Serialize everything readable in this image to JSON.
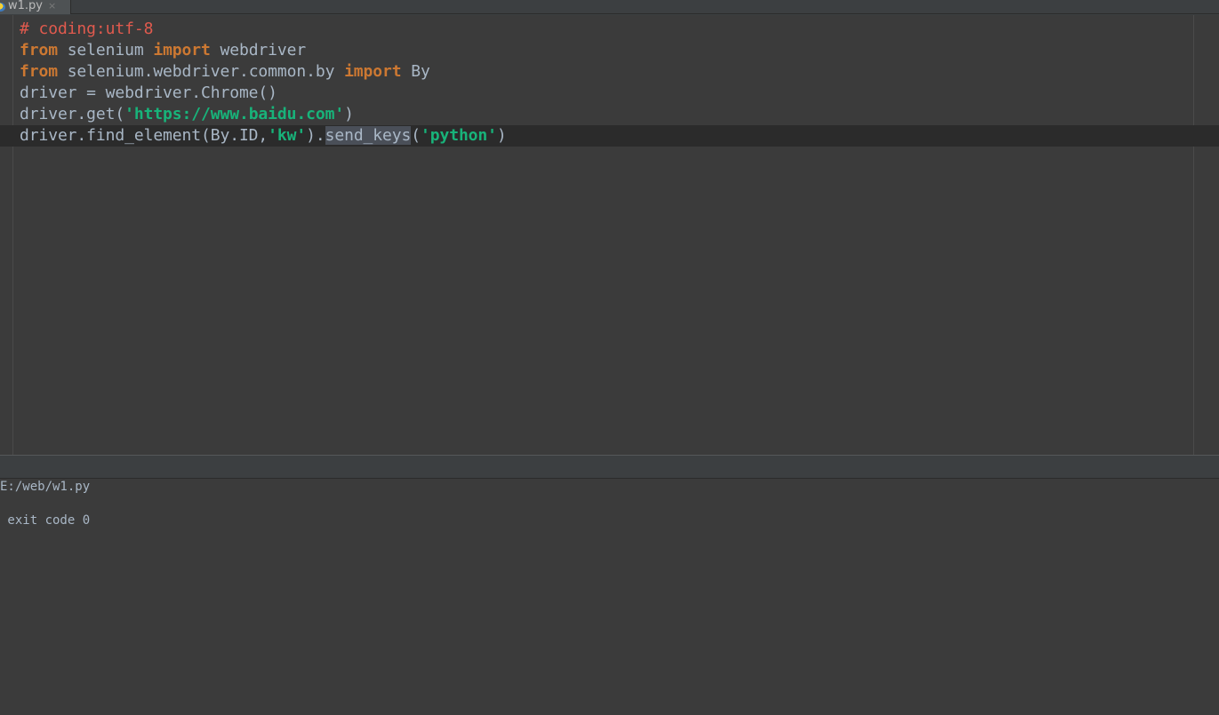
{
  "tab": {
    "file_name": "w1.py",
    "close_glyph": "×"
  },
  "editor": {
    "lines": [
      [
        {
          "t": "comment",
          "v": "# coding:utf-8"
        }
      ],
      [
        {
          "t": "keyword",
          "v": "from"
        },
        {
          "t": "plain",
          "v": " selenium "
        },
        {
          "t": "keyword",
          "v": "import"
        },
        {
          "t": "plain",
          "v": " webdriver"
        }
      ],
      [
        {
          "t": "keyword",
          "v": "from"
        },
        {
          "t": "plain",
          "v": " selenium.webdriver.common.by "
        },
        {
          "t": "keyword",
          "v": "import"
        },
        {
          "t": "plain",
          "v": " By"
        }
      ],
      [
        {
          "t": "plain",
          "v": "driver = webdriver.Chrome()"
        }
      ],
      [
        {
          "t": "plain",
          "v": "driver.get("
        },
        {
          "t": "string",
          "v": "'https://www.baidu.com'"
        },
        {
          "t": "plain",
          "v": ")"
        }
      ],
      [
        {
          "t": "plain",
          "v": "driver.find_element(By.ID,"
        },
        {
          "t": "string",
          "v": "'kw'"
        },
        {
          "t": "plain",
          "v": ")."
        },
        {
          "t": "hl",
          "v": "send_keys"
        },
        {
          "t": "plain",
          "v": "("
        },
        {
          "t": "string",
          "v": "'python'"
        },
        {
          "t": "plain",
          "v": ")"
        }
      ]
    ],
    "current_line_index": 5
  },
  "console": {
    "lines": [
      "E:/web/w1.py",
      "",
      " exit code 0"
    ]
  },
  "colors": {
    "background": "#3b3b3b",
    "comment": "#e05a4e",
    "keyword": "#cc7832",
    "string": "#18b37a",
    "plain": "#a9b7c6",
    "current_line": "#2b2b2b"
  }
}
